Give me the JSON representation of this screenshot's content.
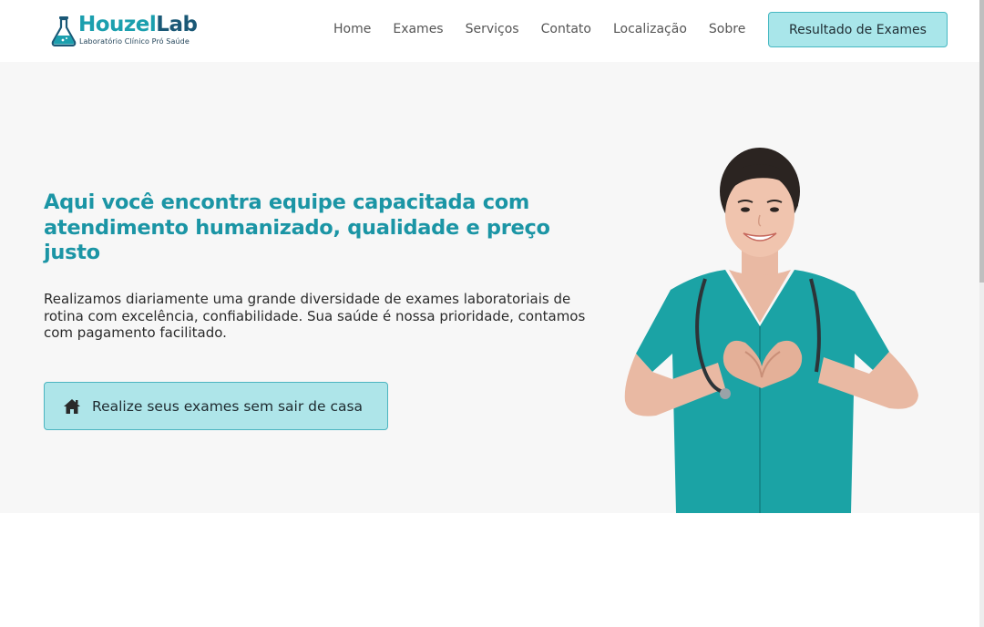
{
  "brand": {
    "name_part1": "Houzel",
    "name_part2": "Lab",
    "tagline": "Laboratório Clínico Pró Saúde",
    "primary_color": "#1b9fae",
    "dark_color": "#1a5876"
  },
  "nav": {
    "items": [
      "Home",
      "Exames",
      "Serviços",
      "Contato",
      "Localização",
      "Sobre"
    ],
    "cta_label": "Resultado de Exames"
  },
  "hero": {
    "title": "Aqui você encontra equipe capacitada com atendimento humanizado, qualidade e preço justo",
    "text": "Realizamos diariamente uma grande diversidade de exames laboratoriais de rotina com excelência, confiabilidade. Sua saúde é nossa prioridade, contamos com pagamento facilitado.",
    "button_label": "Realize seus exames sem sair de casa",
    "button_icon": "home-icon",
    "image": "nurse-heart-hands-photo",
    "background": "#f7f7f7",
    "accent": "#aee5e9"
  }
}
